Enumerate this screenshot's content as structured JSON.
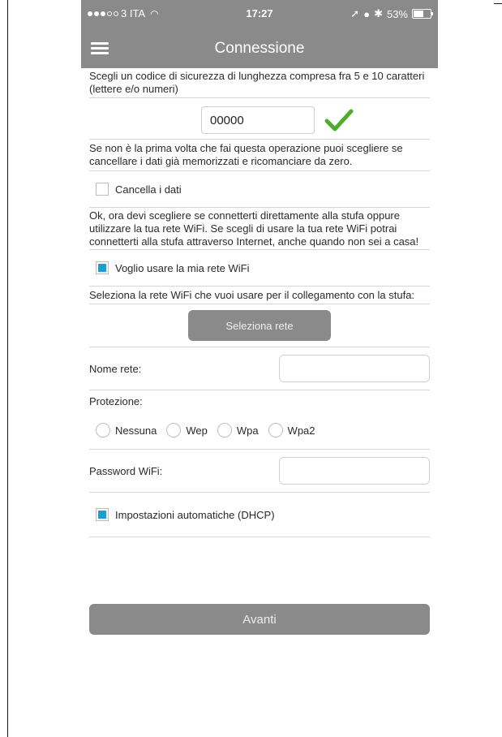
{
  "status_bar": {
    "carrier": "3 ITA",
    "time": "17:27",
    "battery": "53%",
    "battery_level": 0.53
  },
  "nav": {
    "title": "Connessione",
    "menu_icon": "hamburger-menu-icon"
  },
  "security": {
    "instructions": "Scegli un codice di sicurezza di lunghezza compresa fra 5 e 10 caratteri (lettere e/o numeri)",
    "code_value": "00000",
    "valid_icon": "checkmark-icon",
    "valid_color": "#4caf28"
  },
  "reset": {
    "instructions": "Se non è la prima volta che fai questa operazione puoi scegliere se cancellare i dati già memorizzati e ricomanciare da zero.",
    "checkbox_label": "Cancella i dati",
    "checked": false
  },
  "wifi_choice": {
    "instructions": "Ok, ora devi scegliere se connetterti direttamente alla stufa oppure utilizzare la tua rete  WiFi. Se scegli di usare la tua rete WiFi potrai connetterti alla stufa attraverso Internet, anche quando non sei a casa!",
    "checkbox_label": "Voglio usare la mia rete WiFi",
    "checked": true
  },
  "network": {
    "instructions": "Seleziona la rete WiFi che vuoi usare per il collegamento con la stufa:",
    "select_button": "Seleziona rete",
    "name_label": "Nome rete:",
    "name_value": "",
    "protection_label": "Protezione:",
    "protection_options": [
      "Nessuna",
      "Wep",
      "Wpa",
      "Wpa2"
    ],
    "password_label": "Password WiFi:",
    "password_value": "",
    "dhcp_label": "Impostazioni automatiche (DHCP)",
    "dhcp_checked": true
  },
  "footer": {
    "next_button": "Avanti"
  },
  "colors": {
    "header_gray": "#8a8a8a",
    "checkbox_blue": "#1a9ed6"
  }
}
